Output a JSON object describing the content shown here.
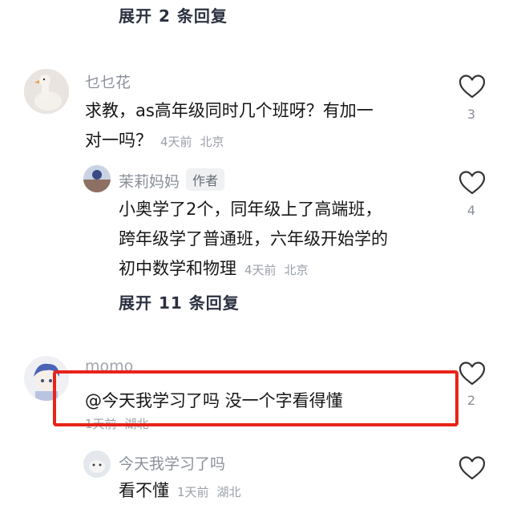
{
  "thread_top": {
    "expand_label": "展开 2 条回复"
  },
  "comment1": {
    "username": "乜乜花",
    "text_line1": "求教，as高年级同时几个班呀？有加一",
    "text_line2": "对一吗？",
    "time": "4天前",
    "location": "北京",
    "likes": "3",
    "reply": {
      "username": "茉莉妈妈",
      "badge": "作者",
      "text_line1": "小奥学了2个，同年级上了高端班，",
      "text_line2": "跨年级学了普通班，六年级开始学的",
      "text_line3": "初中数学和物理",
      "time": "4天前",
      "location": "北京",
      "likes": "4"
    },
    "expand_label": "展开 11 条回复"
  },
  "comment2": {
    "username": "momo",
    "text": "@今天我学习了吗 没一个字看得懂",
    "time": "1天前",
    "location": "湖北",
    "likes": "2",
    "reply": {
      "username": "今天我学习了吗",
      "text": "看不懂",
      "time": "1天前",
      "location": "湖北"
    }
  },
  "colors": {
    "highlight_border": "#e8231a",
    "meta_gray": "#9aa0a8"
  },
  "icons": {
    "like": "heart-outline-icon"
  }
}
